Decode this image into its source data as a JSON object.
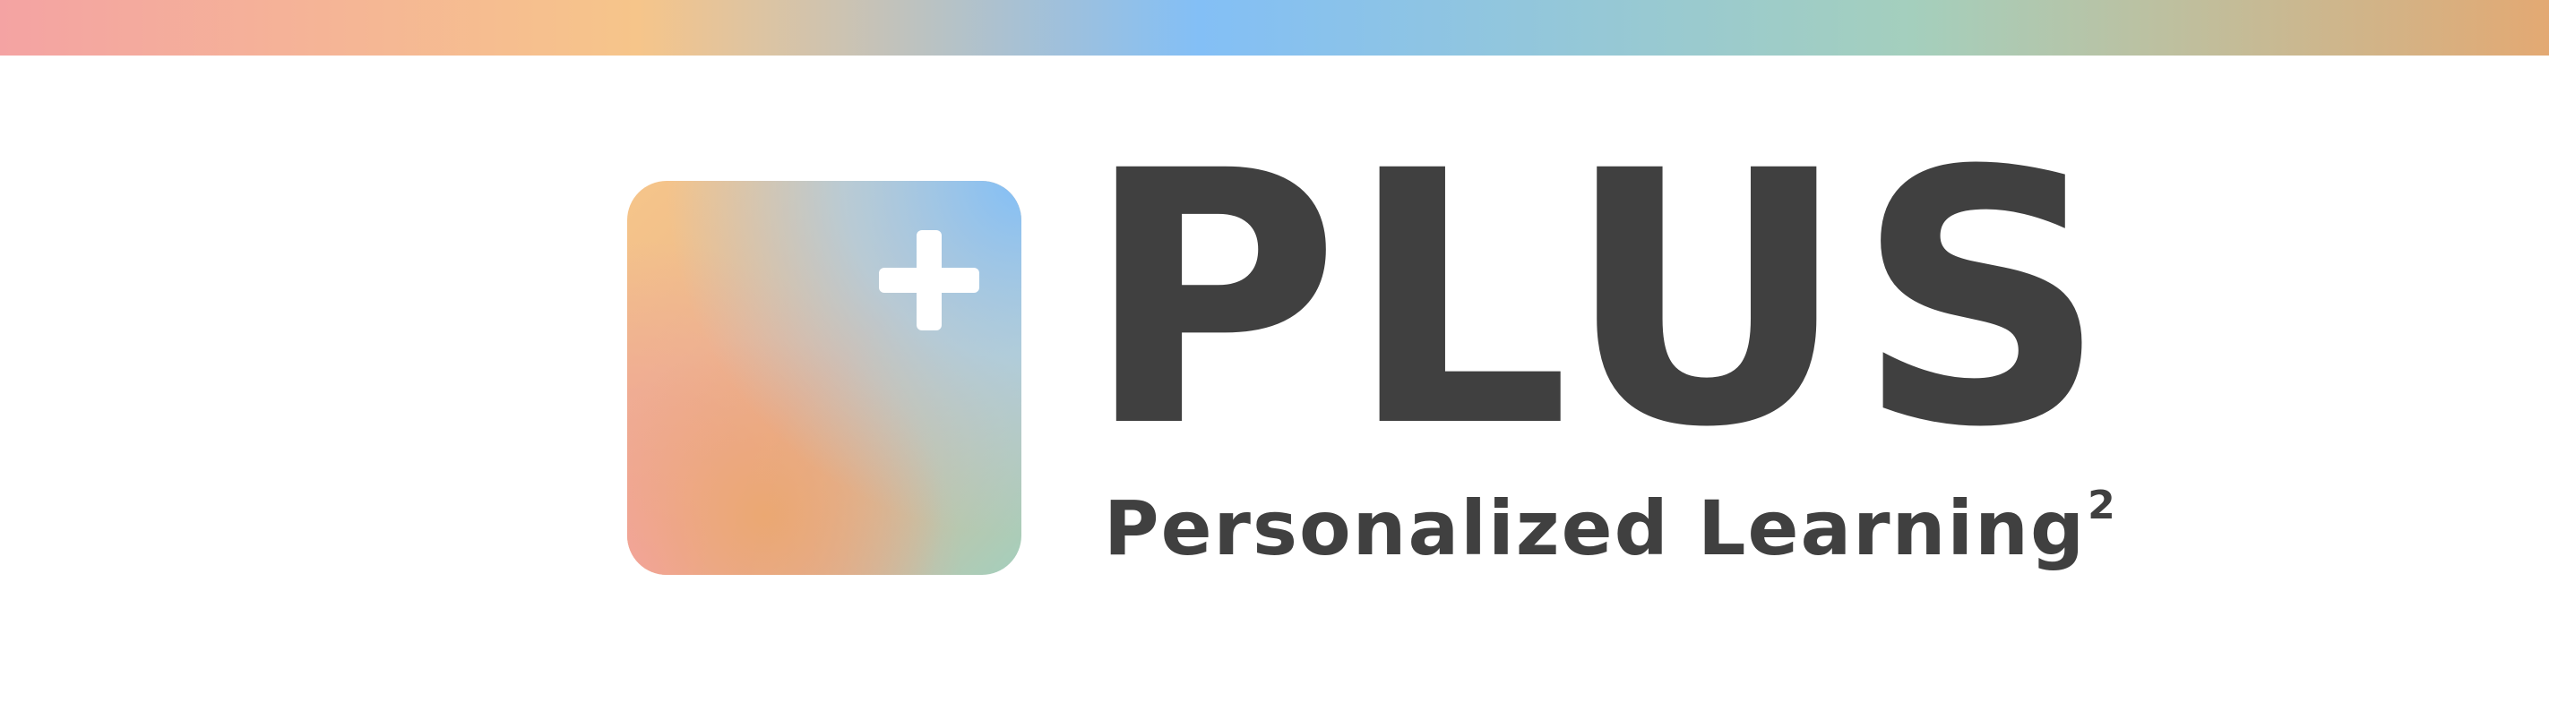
{
  "brand": {
    "name": "PLUS",
    "tagline": "Personalized Learning",
    "tagline_superscript": "2"
  },
  "icons": {
    "logo_mark": "plus-icon"
  },
  "colors": {
    "text": "#404040",
    "background": "#ffffff",
    "gradient_pink": "#f4a3a3",
    "gradient_orange": "#f6c58a",
    "gradient_blue": "#83bff6",
    "gradient_green": "#a4cfbd",
    "gradient_tan": "#e3a973"
  }
}
